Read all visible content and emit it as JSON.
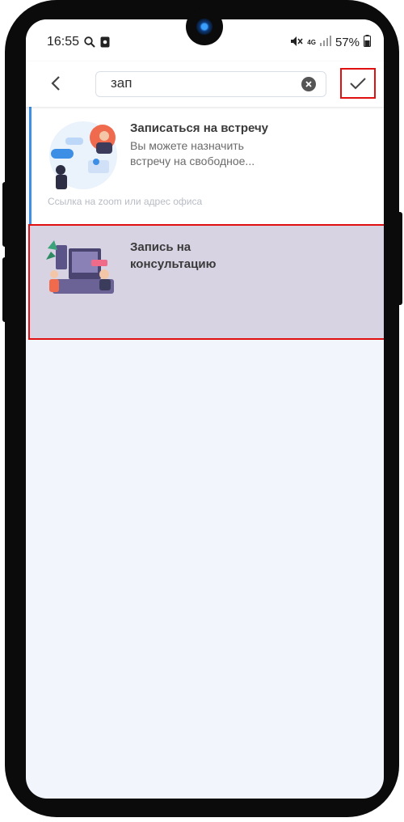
{
  "status_bar": {
    "time": "16:55",
    "battery": "57%",
    "network": "4G"
  },
  "search": {
    "value": "зап"
  },
  "icons": {
    "back": "chevron-left-icon",
    "clear": "close-circle-icon",
    "confirm": "checkmark-icon"
  },
  "results": [
    {
      "title": "Записаться на встречу",
      "description_line1": "Вы можете назначить",
      "description_line2": "встречу на свободное...",
      "link": "Ссылка на zoom или адрес офиса",
      "accent": "#3d8fe6"
    },
    {
      "title_line1": "Запись на",
      "title_line2": "консультацию",
      "selected": true
    }
  ],
  "colors": {
    "highlight_border": "#e11010",
    "selected_bg": "#d8d3e3",
    "screen_bg": "#f2f6fc"
  }
}
